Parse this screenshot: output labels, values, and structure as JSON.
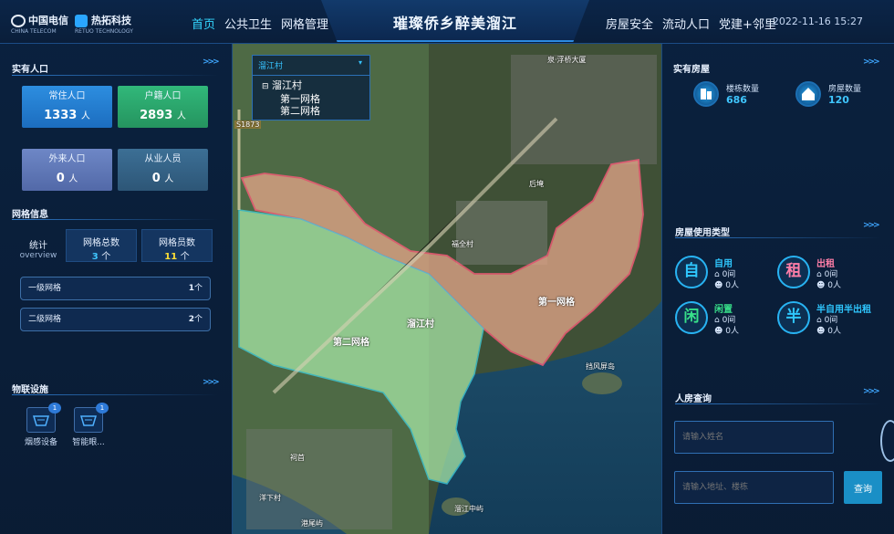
{
  "header": {
    "logo_telecom": "中国电信",
    "logo_telecom_sub": "CHINA TELECOM",
    "logo_rt": "热拓科技",
    "logo_rt_sub": "RETUO TECHNOLOGY",
    "nav_left": [
      "首页",
      "公共卫生",
      "网格管理"
    ],
    "title": "璀璨侨乡醉美溜江",
    "nav_right": [
      "房屋安全",
      "流动人口",
      "党建+邻里"
    ],
    "datetime": "2022-11-16 15:27"
  },
  "left": {
    "population_title": "实有人口",
    "cards": [
      {
        "label": "常住人口",
        "value": "1333",
        "unit": "人"
      },
      {
        "label": "户籍人口",
        "value": "2893",
        "unit": "人"
      },
      {
        "label": "外来人口",
        "value": "0",
        "unit": "人"
      },
      {
        "label": "从业人员",
        "value": "0",
        "unit": "人"
      }
    ],
    "grid_title": "网格信息",
    "grid_stat_label": "统计",
    "grid_stat_sub": "overview",
    "grid_total_label": "网格总数",
    "grid_total_value": "3",
    "grid_total_unit": "个",
    "grid_staff_label": "网格员数",
    "grid_staff_value": "11",
    "grid_staff_unit": "个",
    "grid_rows": [
      {
        "label": "一级网格",
        "value": "1",
        "unit": "个"
      },
      {
        "label": "二级网格",
        "value": "2",
        "unit": "个"
      }
    ],
    "iot_title": "物联设施",
    "devices": [
      {
        "label": "烟感设备",
        "count": "1"
      },
      {
        "label": "智能眼...",
        "count": "1"
      }
    ]
  },
  "map": {
    "tree_head": "溜江村",
    "tree_root": "溜江村",
    "tree_children": [
      "第一网格",
      "第二网格"
    ],
    "labels": {
      "village": "溜江村",
      "grid1": "第一网格",
      "grid2": "第二网格",
      "houjing": "后埯",
      "fuquan": "福全村",
      "screen": "挡风屏岛",
      "zhongyu": "溜江中屿",
      "gangwei": "港尾屿",
      "zaihu": "祠首",
      "yangcuo": "洋下村",
      "road": "S1873",
      "landmark": "泉·浮桥大厦"
    },
    "colors": {
      "grid1": "#e0a487",
      "grid2": "#9fe0a0"
    }
  },
  "right": {
    "house_title": "实有房屋",
    "building_label": "楼栋数量",
    "building_value": "686",
    "room_label": "房屋数量",
    "room_value": "120",
    "usage_title": "房屋使用类型",
    "usages": [
      {
        "glyph": "自",
        "label": "自用",
        "rooms": "0间",
        "people": "0人",
        "color": "#2fc7ff"
      },
      {
        "glyph": "租",
        "label": "出租",
        "rooms": "0间",
        "people": "0人",
        "color": "#ff7ea8"
      },
      {
        "glyph": "闲",
        "label": "闲置",
        "rooms": "0间",
        "people": "0人",
        "color": "#38e08a"
      },
      {
        "glyph": "半",
        "label": "半自用半出租",
        "rooms": "0间",
        "people": "0人",
        "color": "#2fc7ff"
      }
    ],
    "query_title": "人房查询",
    "name_placeholder": "请输入姓名",
    "address_placeholder": "请输入地址、楼栋",
    "query_button": "查询"
  }
}
